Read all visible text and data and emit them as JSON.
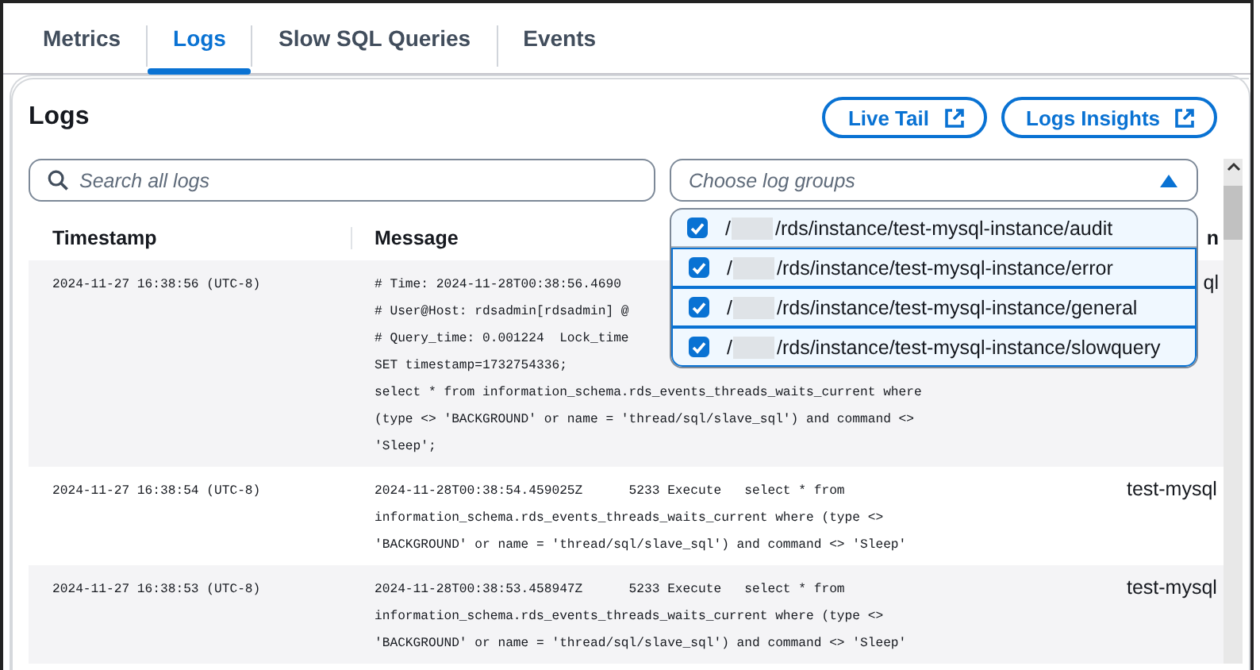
{
  "tabs": [
    {
      "label": "Metrics",
      "selected": false
    },
    {
      "label": "Logs",
      "selected": true
    },
    {
      "label": "Slow SQL Queries",
      "selected": false
    },
    {
      "label": "Events",
      "selected": false
    }
  ],
  "panel": {
    "title": "Logs",
    "buttons": [
      {
        "label": "Live Tail"
      },
      {
        "label": "Logs Insights"
      }
    ]
  },
  "search": {
    "placeholder": "Search all logs"
  },
  "log_group_select": {
    "placeholder": "Choose log groups",
    "expanded": true,
    "options": [
      {
        "prefix": "/",
        "path": "/rds/instance/test-mysql-instance/audit",
        "checked": true
      },
      {
        "prefix": "/",
        "path": "/rds/instance/test-mysql-instance/error",
        "checked": true
      },
      {
        "prefix": "/",
        "path": "/rds/instance/test-mysql-instance/general",
        "checked": true
      },
      {
        "prefix": "/",
        "path": "/rds/instance/test-mysql-instance/slowquery",
        "checked": true
      }
    ]
  },
  "table": {
    "columns": [
      "Timestamp",
      "Message",
      "n"
    ],
    "rows": [
      {
        "timestamp": "2024-11-27 16:38:56 (UTC-8)",
        "message_lines": [
          "# Time: 2024-11-28T00:38:56.4690",
          "# User@Host: rdsadmin[rdsadmin] @",
          "# Query_time: 0.001224  Lock_time",
          "SET timestamp=1732754336;",
          "select * from information_schema.rds_events_threads_waits_current where",
          "(type <> 'BACKGROUND' or name = 'thread/sql/slave_sql') and command <>",
          "'Sleep';"
        ],
        "column_3": "ql"
      },
      {
        "timestamp": "2024-11-27 16:38:54 (UTC-8)",
        "message_lines": [
          "2024-11-28T00:38:54.459025Z      5233 Execute   select * from",
          "information_schema.rds_events_threads_waits_current where (type <>",
          "'BACKGROUND' or name = 'thread/sql/slave_sql') and command <> 'Sleep'"
        ],
        "column_3": "test-mysql"
      },
      {
        "timestamp": "2024-11-27 16:38:53 (UTC-8)",
        "message_lines": [
          "2024-11-28T00:38:53.458947Z      5233 Execute   select * from",
          "information_schema.rds_events_threads_waits_current where (type <>",
          "'BACKGROUND' or name = 'thread/sql/slave_sql') and command <> 'Sleep'"
        ],
        "column_3": "test-mysql"
      }
    ]
  }
}
